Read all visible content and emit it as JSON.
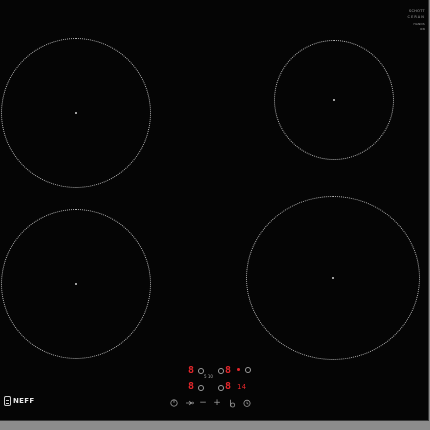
{
  "brand": {
    "logo_word": "NEFF",
    "badge_lines": [
      "SCHOTT",
      "CERAN",
      "HANDS",
      "ON"
    ]
  },
  "zones": [
    {
      "id": "front-left",
      "icon": "cooking-zone"
    },
    {
      "id": "rear-left",
      "icon": "cooking-zone"
    },
    {
      "id": "front-right",
      "icon": "cooking-zone"
    },
    {
      "id": "rear-right",
      "icon": "cooking-zone"
    }
  ],
  "display": {
    "zone_left_top_digit": "8",
    "zone_left_bottom_digit": "8",
    "zone_right_top_digit": "8",
    "zone_right_bottom_digit": "8",
    "timer_value": "14",
    "small_label": "5 10"
  },
  "controls": {
    "power_icon": "power-icon",
    "boost_icon": "boost-icon",
    "minus_label": "−",
    "plus_label": "+",
    "lock_icon": "child-lock-icon",
    "timer_icon": "timer-icon"
  },
  "colors": {
    "glass": "#050505",
    "display_red": "#e5262b",
    "zone_outline": "#b8b8b8",
    "surround": "#8c8c8c"
  }
}
